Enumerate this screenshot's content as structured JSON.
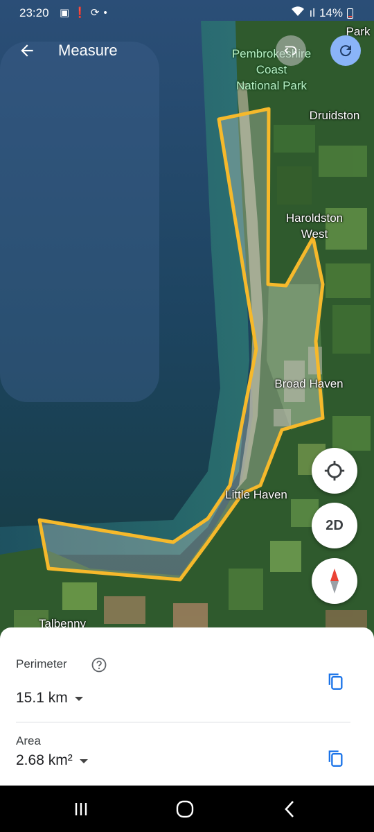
{
  "status_bar": {
    "time": "23:20",
    "left_icons": [
      "image-icon",
      "alert-icon",
      "sync-icon",
      "dot-icon"
    ],
    "signal": "ıl",
    "battery": "14%"
  },
  "app_bar": {
    "title": "Measure",
    "back_icon": "arrow-back-icon",
    "undo_icon": "undo-icon",
    "redo_icon": "redo-icon"
  },
  "map": {
    "places": [
      {
        "name": "Pembrokeshire\nCoast\nNational Park",
        "kind": "park"
      },
      {
        "name": "Druidston",
        "kind": "town"
      },
      {
        "name": "Haroldston\nWest",
        "kind": "town"
      },
      {
        "name": "Broad Haven",
        "kind": "town"
      },
      {
        "name": "Little Haven",
        "kind": "town"
      },
      {
        "name": "Talbenny",
        "kind": "town"
      },
      {
        "name": "Park",
        "kind": "town"
      }
    ],
    "polygon_color": "#f6b92b",
    "fabs": {
      "location_icon": "my-location-icon",
      "view_mode_label": "2D",
      "compass_icon": "compass-icon"
    }
  },
  "sheet": {
    "perimeter_label": "Perimeter",
    "perimeter_value": "15.1 km",
    "area_label": "Area",
    "area_value": "2.68 km²",
    "help_icon": "help-icon",
    "copy_icon": "copy-icon",
    "accent_color": "#1a73e8"
  },
  "nav_bar": {
    "recent_icon": "recent-apps-icon",
    "home_icon": "home-icon",
    "back_icon": "nav-back-icon"
  }
}
